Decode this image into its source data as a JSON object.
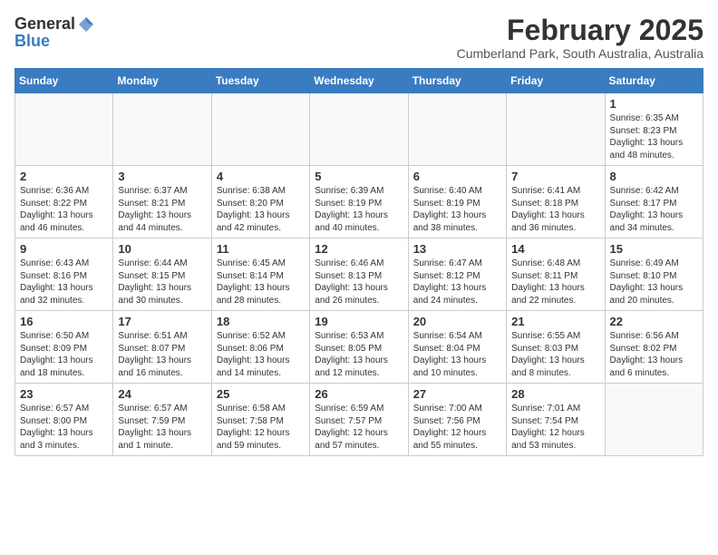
{
  "logo": {
    "general": "General",
    "blue": "Blue"
  },
  "title": "February 2025",
  "subtitle": "Cumberland Park, South Australia, Australia",
  "days": [
    "Sunday",
    "Monday",
    "Tuesday",
    "Wednesday",
    "Thursday",
    "Friday",
    "Saturday"
  ],
  "weeks": [
    [
      {
        "day": "",
        "empty": true
      },
      {
        "day": "",
        "empty": true
      },
      {
        "day": "",
        "empty": true
      },
      {
        "day": "",
        "empty": true
      },
      {
        "day": "",
        "empty": true
      },
      {
        "day": "",
        "empty": true
      },
      {
        "day": "1",
        "sunrise": "6:35 AM",
        "sunset": "8:23 PM",
        "daylight": "13 hours and 48 minutes."
      }
    ],
    [
      {
        "day": "2",
        "sunrise": "6:36 AM",
        "sunset": "8:22 PM",
        "daylight": "13 hours and 46 minutes."
      },
      {
        "day": "3",
        "sunrise": "6:37 AM",
        "sunset": "8:21 PM",
        "daylight": "13 hours and 44 minutes."
      },
      {
        "day": "4",
        "sunrise": "6:38 AM",
        "sunset": "8:20 PM",
        "daylight": "13 hours and 42 minutes."
      },
      {
        "day": "5",
        "sunrise": "6:39 AM",
        "sunset": "8:19 PM",
        "daylight": "13 hours and 40 minutes."
      },
      {
        "day": "6",
        "sunrise": "6:40 AM",
        "sunset": "8:19 PM",
        "daylight": "13 hours and 38 minutes."
      },
      {
        "day": "7",
        "sunrise": "6:41 AM",
        "sunset": "8:18 PM",
        "daylight": "13 hours and 36 minutes."
      },
      {
        "day": "8",
        "sunrise": "6:42 AM",
        "sunset": "8:17 PM",
        "daylight": "13 hours and 34 minutes."
      }
    ],
    [
      {
        "day": "9",
        "sunrise": "6:43 AM",
        "sunset": "8:16 PM",
        "daylight": "13 hours and 32 minutes."
      },
      {
        "day": "10",
        "sunrise": "6:44 AM",
        "sunset": "8:15 PM",
        "daylight": "13 hours and 30 minutes."
      },
      {
        "day": "11",
        "sunrise": "6:45 AM",
        "sunset": "8:14 PM",
        "daylight": "13 hours and 28 minutes."
      },
      {
        "day": "12",
        "sunrise": "6:46 AM",
        "sunset": "8:13 PM",
        "daylight": "13 hours and 26 minutes."
      },
      {
        "day": "13",
        "sunrise": "6:47 AM",
        "sunset": "8:12 PM",
        "daylight": "13 hours and 24 minutes."
      },
      {
        "day": "14",
        "sunrise": "6:48 AM",
        "sunset": "8:11 PM",
        "daylight": "13 hours and 22 minutes."
      },
      {
        "day": "15",
        "sunrise": "6:49 AM",
        "sunset": "8:10 PM",
        "daylight": "13 hours and 20 minutes."
      }
    ],
    [
      {
        "day": "16",
        "sunrise": "6:50 AM",
        "sunset": "8:09 PM",
        "daylight": "13 hours and 18 minutes."
      },
      {
        "day": "17",
        "sunrise": "6:51 AM",
        "sunset": "8:07 PM",
        "daylight": "13 hours and 16 minutes."
      },
      {
        "day": "18",
        "sunrise": "6:52 AM",
        "sunset": "8:06 PM",
        "daylight": "13 hours and 14 minutes."
      },
      {
        "day": "19",
        "sunrise": "6:53 AM",
        "sunset": "8:05 PM",
        "daylight": "13 hours and 12 minutes."
      },
      {
        "day": "20",
        "sunrise": "6:54 AM",
        "sunset": "8:04 PM",
        "daylight": "13 hours and 10 minutes."
      },
      {
        "day": "21",
        "sunrise": "6:55 AM",
        "sunset": "8:03 PM",
        "daylight": "13 hours and 8 minutes."
      },
      {
        "day": "22",
        "sunrise": "6:56 AM",
        "sunset": "8:02 PM",
        "daylight": "13 hours and 6 minutes."
      }
    ],
    [
      {
        "day": "23",
        "sunrise": "6:57 AM",
        "sunset": "8:00 PM",
        "daylight": "13 hours and 3 minutes."
      },
      {
        "day": "24",
        "sunrise": "6:57 AM",
        "sunset": "7:59 PM",
        "daylight": "13 hours and 1 minute."
      },
      {
        "day": "25",
        "sunrise": "6:58 AM",
        "sunset": "7:58 PM",
        "daylight": "12 hours and 59 minutes."
      },
      {
        "day": "26",
        "sunrise": "6:59 AM",
        "sunset": "7:57 PM",
        "daylight": "12 hours and 57 minutes."
      },
      {
        "day": "27",
        "sunrise": "7:00 AM",
        "sunset": "7:56 PM",
        "daylight": "12 hours and 55 minutes."
      },
      {
        "day": "28",
        "sunrise": "7:01 AM",
        "sunset": "7:54 PM",
        "daylight": "12 hours and 53 minutes."
      },
      {
        "day": "",
        "empty": true
      }
    ]
  ]
}
